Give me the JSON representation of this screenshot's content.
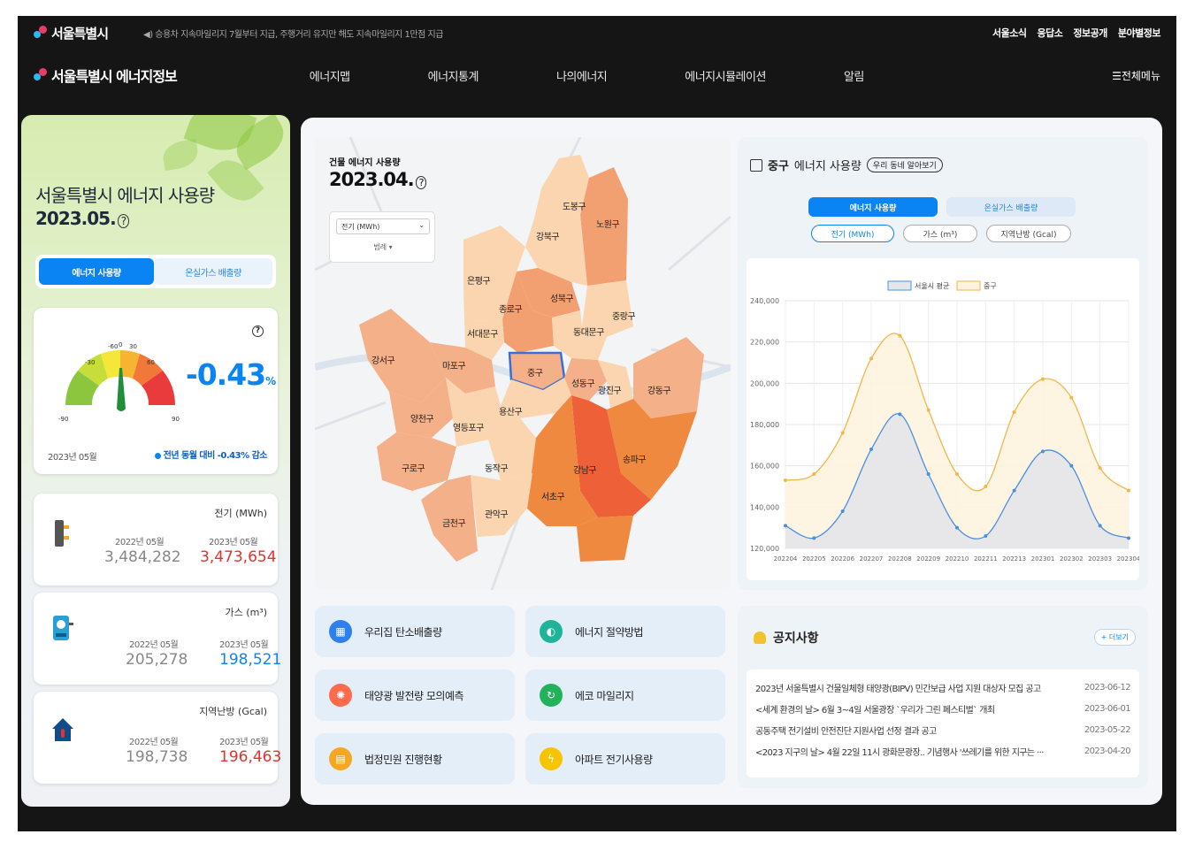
{
  "util": {
    "brand": "서울특별시",
    "ticker": "◀) 승용차 지속마일리지 7월부터 지급, 주행거리 유지만 해도 지속마일리지 1만점 지급",
    "links": [
      "서울소식",
      "응답소",
      "정보공개",
      "분야별정보"
    ]
  },
  "gnb": {
    "brand": "서울특별시 에너지정보",
    "menu": [
      "에너지맵",
      "에너지통계",
      "나의에너지",
      "에너지시뮬레이션",
      "알림"
    ],
    "all_menu": "☰전체메뉴"
  },
  "left": {
    "title": "서울특별시 에너지 사용량",
    "date": "2023.05.",
    "tabs": [
      "에너지 사용량",
      "온실가스 배출량"
    ],
    "gauge": {
      "change": "-0.43",
      "unit": "%",
      "ticks": [
        "-60",
        "-30",
        "0",
        "30",
        "60",
        "-90",
        "90"
      ],
      "period": "2023년 05월",
      "summary": "전년 동월 대비 -0.43% 감소"
    },
    "stats": [
      {
        "label": "전기 (MWh)",
        "prev_label": "2022년 05월",
        "prev_value": "3,484,282",
        "cur_label": "2023년 05월",
        "cur_value": "3,473,654"
      },
      {
        "label": "가스 (m³)",
        "prev_label": "2022년 05월",
        "prev_value": "205,278",
        "cur_label": "2023년 05월",
        "cur_value": "198,521"
      },
      {
        "label": "지역난방 (Gcal)",
        "prev_label": "2022년 05월",
        "prev_value": "198,738",
        "cur_label": "2023년 05월",
        "cur_value": "196,463"
      }
    ]
  },
  "map": {
    "label": "건물 에너지 사용량",
    "date": "2023.04.",
    "select": "전기 (MWh)",
    "legend": "범례 ▾",
    "districts": [
      "도봉구",
      "노원구",
      "강북구",
      "은평구",
      "성북구",
      "중랑구",
      "종로구",
      "서대문구",
      "동대문구",
      "강서구",
      "마포구",
      "중구",
      "성동구",
      "광진구",
      "강동구",
      "양천구",
      "용산구",
      "영등포구",
      "송파구",
      "구로구",
      "동작구",
      "강남구",
      "서초구",
      "금천구",
      "관악구"
    ]
  },
  "chart_panel": {
    "title_bold": "중구",
    "title_rest": "에너지 사용량",
    "neighborhood_btn": "우리 동네 알아보기",
    "tabs": [
      "에너지 사용량",
      "온실가스 배출량"
    ],
    "subtabs": [
      "전기 (MWh)",
      "가스 (m³)",
      "지역난방 (Gcal)"
    ]
  },
  "chart_data": {
    "type": "area",
    "x": [
      "202204",
      "202205",
      "202206",
      "202207",
      "202208",
      "202209",
      "202210",
      "202211",
      "202212",
      "202301",
      "202302",
      "202303",
      "202304"
    ],
    "x_labels": [
      "202204",
      "202205",
      "202206",
      "202207",
      "202208",
      "202209",
      "202210",
      "202211",
      "202213",
      "202301",
      "202302",
      "202303",
      "202304"
    ],
    "ylim": [
      120000,
      240000
    ],
    "yticks": [
      "120,000",
      "140,000",
      "160,000",
      "180,000",
      "200,000",
      "220,000",
      "240,000"
    ],
    "legend_position": "top",
    "grid": true,
    "series": [
      {
        "name": "서울시 평균",
        "color": "#4a90e2",
        "fill": "#e4e6ea",
        "values": [
          131000,
          125000,
          138000,
          168000,
          185000,
          156000,
          130000,
          126000,
          148000,
          167000,
          160000,
          131000,
          125000
        ]
      },
      {
        "name": "중구",
        "color": "#f0b74a",
        "fill": "#fdf3df",
        "values": [
          153000,
          156000,
          176000,
          212000,
          223000,
          187000,
          156000,
          150000,
          186000,
          202000,
          193000,
          159000,
          148000
        ]
      }
    ]
  },
  "shortcuts": [
    {
      "label": "우리집 탄소배출량",
      "icon": "building-icon",
      "color": "#2f80ed"
    },
    {
      "label": "에너지 절약방법",
      "icon": "bulb-icon",
      "color": "#1fb39a"
    },
    {
      "label": "태양광 발전량 모의예측",
      "icon": "sun-icon",
      "color": "#ff6b4a"
    },
    {
      "label": "에코 마일리지",
      "icon": "eco-icon",
      "color": "#22b35a"
    },
    {
      "label": "법정민원 진행현황",
      "icon": "document-icon",
      "color": "#f5a623"
    },
    {
      "label": "아파트 전기사용량",
      "icon": "bolt-icon",
      "color": "#f7c400"
    }
  ],
  "notice": {
    "title": "공지사항",
    "more": "+ 더보기",
    "items": [
      {
        "title": "2023년 서울특별시 건물일체형 태양광(BIPV) 민간보급 사업 지원 대상자 모집 공고",
        "date": "2023-06-12"
      },
      {
        "title": "<세계 환경의 날> 6월 3~4일 서울광장 `우리가 그린 페스티벌` 개최",
        "date": "2023-06-01"
      },
      {
        "title": "공동주택 전기설비 안전진단 지원사업 선정 결과 공고",
        "date": "2023-05-22"
      },
      {
        "title": "<2023 지구의 날> 4월 22일 11시 광화문광장.. 기념행사 '쓰레기를 위한 지구는 ···",
        "date": "2023-04-20"
      }
    ]
  }
}
